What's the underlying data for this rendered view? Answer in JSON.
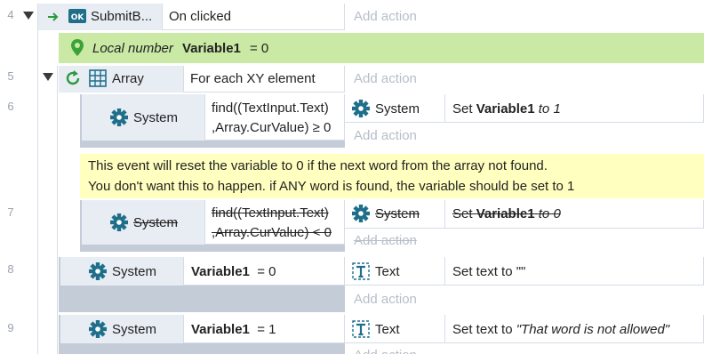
{
  "rows": {
    "r4": "4",
    "r5": "5",
    "r6": "6",
    "r7": "7",
    "r8": "8",
    "r9": "9"
  },
  "event4": {
    "object_name": "SubmitB...",
    "condition": "On clicked",
    "add_action": "Add action"
  },
  "local_var": {
    "prefix": "Local number",
    "name": "Variable1",
    "value": "= 0"
  },
  "event5": {
    "object_name": "Array",
    "condition": "For each XY element",
    "add_action": "Add action"
  },
  "event6": {
    "object_name": "System",
    "condition_line1": "find((TextInput.Text)",
    "condition_line2": ",Array.CurValue) ≥ 0",
    "action_object": "System",
    "action_prefix": "Set",
    "action_var": "Variable1",
    "action_to": "to",
    "action_value": "1",
    "add_action": "Add action"
  },
  "comment": {
    "line1": "This event will reset the variable to 0 if the next word from the array not found.",
    "line2": "You don't want this to happen. if ANY word is found, the variable should be set to 1"
  },
  "event7": {
    "object_name": "System",
    "condition_line1": "find((TextInput.Text)",
    "condition_line2": ",Array.CurValue) < 0",
    "action_object": "System",
    "action_prefix": "Set",
    "action_var": "Variable1",
    "action_to": "to",
    "action_value": "0",
    "add_action": "Add action"
  },
  "event8": {
    "object_name": "System",
    "condition_var": "Variable1",
    "condition_rest": "= 0",
    "action_object": "Text",
    "action_text": "Set text to \"\"",
    "add_action": "Add action"
  },
  "event9": {
    "object_name": "System",
    "condition_var": "Variable1",
    "condition_rest": "= 1",
    "action_object": "Text",
    "action_prefix": "Set text to",
    "action_value": "\"That word is not allowed\"",
    "add_action": "Add action"
  },
  "icons": {
    "trigger": "arrow-right-icon",
    "button": "ok-button-icon",
    "location": "map-pin-icon",
    "loop": "loop-icon",
    "array": "grid-icon",
    "system": "gear-icon",
    "text": "text-object-icon",
    "collapse": "collapse-triangle-icon"
  },
  "colors": {
    "local_var_bg": "#c9e9a4",
    "comment_bg": "#ffffbf",
    "system_icon": "#1f6f8b",
    "trigger_icon": "#2a9a3a",
    "text_icon": "#1f6f8b",
    "add_action_text": "#b7bec9"
  }
}
